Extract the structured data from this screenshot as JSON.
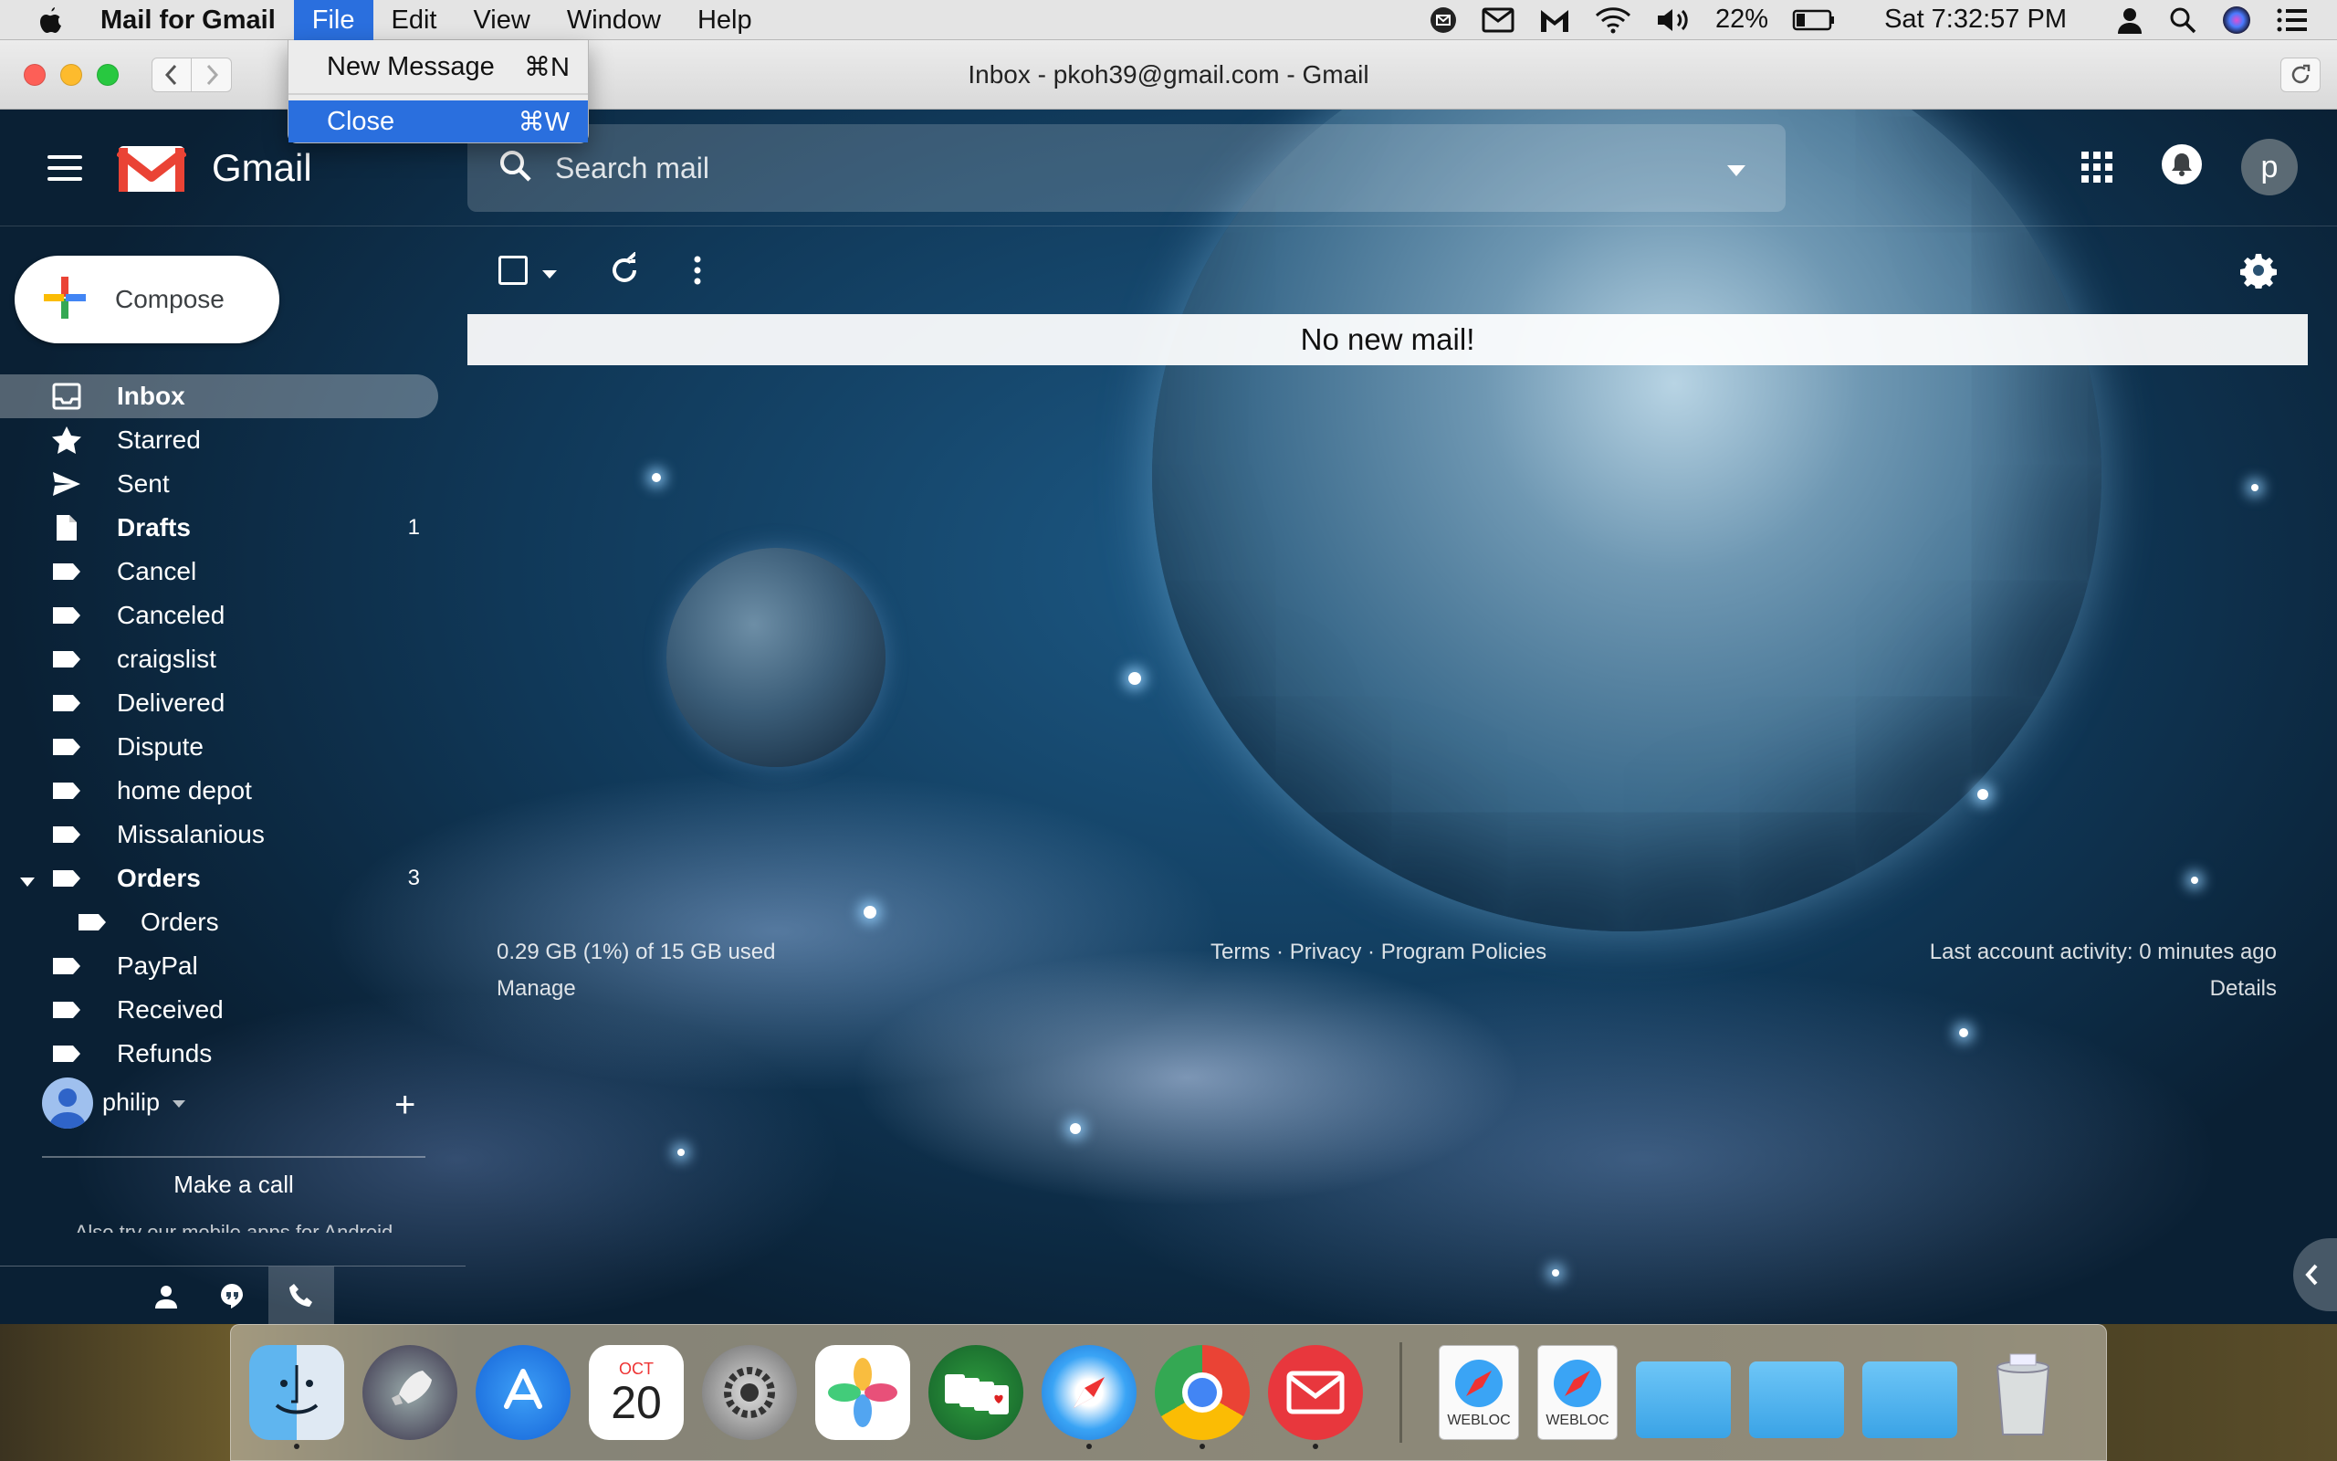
{
  "menubar": {
    "app_name": "Mail for Gmail",
    "menus": [
      "File",
      "Edit",
      "View",
      "Window",
      "Help"
    ],
    "battery": "22%",
    "clock": "Sat 7:32:57 PM"
  },
  "file_menu": {
    "items": [
      {
        "label": "New Message",
        "shortcut": "⌘N"
      },
      {
        "label": "Close",
        "shortcut": "⌘W"
      }
    ]
  },
  "window": {
    "title": "Inbox - pkoh39@gmail.com - Gmail"
  },
  "header": {
    "logo_text": "Gmail",
    "search_placeholder": "Search mail",
    "avatar_letter": "p"
  },
  "sidebar": {
    "compose_label": "Compose",
    "items": [
      {
        "label": "Inbox",
        "count": "",
        "icon": "inbox-icon"
      },
      {
        "label": "Starred",
        "count": "",
        "icon": "star-icon"
      },
      {
        "label": "Sent",
        "count": "",
        "icon": "send-icon"
      },
      {
        "label": "Drafts",
        "count": "1",
        "icon": "draft-icon"
      },
      {
        "label": "Cancel",
        "count": "",
        "icon": "label-icon"
      },
      {
        "label": "Canceled",
        "count": "",
        "icon": "label-icon"
      },
      {
        "label": "craigslist",
        "count": "",
        "icon": "label-icon"
      },
      {
        "label": "Delivered",
        "count": "",
        "icon": "label-icon"
      },
      {
        "label": "Dispute",
        "count": "",
        "icon": "label-icon"
      },
      {
        "label": "home depot",
        "count": "",
        "icon": "label-icon"
      },
      {
        "label": "Missalanious",
        "count": "",
        "icon": "label-icon"
      },
      {
        "label": "Orders",
        "count": "3",
        "icon": "label-icon"
      },
      {
        "label": "Orders",
        "count": "",
        "icon": "label-icon"
      },
      {
        "label": "PayPal",
        "count": "",
        "icon": "label-icon"
      },
      {
        "label": "Received",
        "count": "",
        "icon": "label-icon"
      },
      {
        "label": "Refunds",
        "count": "",
        "icon": "label-icon"
      }
    ]
  },
  "hangouts": {
    "user_name": "philip",
    "make_call": "Make a call",
    "android_note": "Also try our mobile apps for Android"
  },
  "main": {
    "no_mail_text": "No new mail!"
  },
  "footer": {
    "storage": "0.29 GB (1%) of 15 GB used",
    "manage": "Manage",
    "terms": "Terms",
    "privacy": "Privacy",
    "policies": "Program Policies",
    "sep": "·",
    "last_activity": "Last account activity: 0 minutes ago",
    "details": "Details"
  },
  "dock": {
    "calendar_month": "OCT",
    "calendar_day": "20",
    "webloc_label": "WEBLOC"
  },
  "colors": {
    "menu_highlight": "#2a6fde",
    "gmail_red": "#ea4335",
    "compose_blue": "#4285f4",
    "compose_green": "#34a853",
    "compose_yellow": "#fbbc04"
  }
}
